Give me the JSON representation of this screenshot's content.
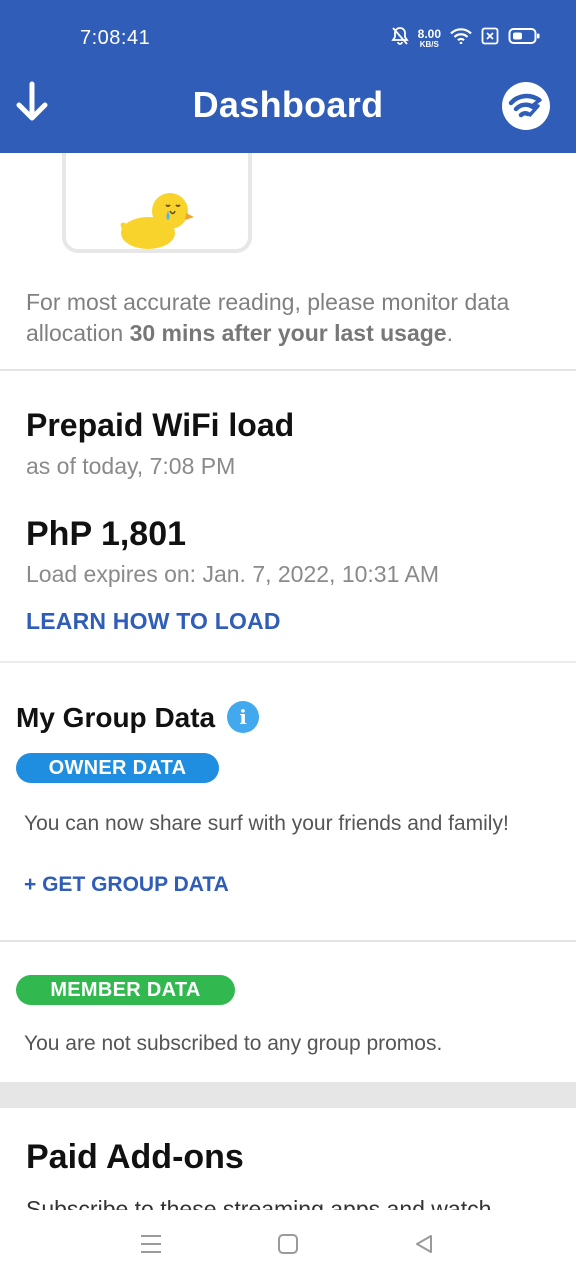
{
  "status_bar": {
    "time": "7:08:41",
    "speed_value": "8.00",
    "speed_unit": "KB/S",
    "icons": [
      "bell-muted-icon",
      "wifi-icon",
      "sim-blocked-icon",
      "battery-icon"
    ]
  },
  "app_bar": {
    "title": "Dashboard",
    "left_icon": "arrow-down-icon",
    "right_icon": "wifi-logo-icon",
    "color": "#2f5db7"
  },
  "usage_note": {
    "text_before": "For most accurate reading, please monitor data allocation ",
    "text_bold": "30 mins after your last usage",
    "text_after": "."
  },
  "prepaid": {
    "title": "Prepaid WiFi load",
    "as_of": "as of today, 7:08 PM",
    "amount": "PhP 1,801",
    "expires": "Load expires on: Jan. 7, 2022, 10:31 AM",
    "learn_link": "LEARN HOW TO LOAD"
  },
  "group_data": {
    "title": "My Group Data",
    "owner_badge": "OWNER DATA",
    "owner_desc": "You can now share surf with your friends and family!",
    "get_link": "+ GET GROUP DATA",
    "member_badge": "MEMBER DATA",
    "member_desc": "You are not subscribed to any group promos.",
    "owner_color": "#1f8ee0",
    "member_color": "#31b94f"
  },
  "addons": {
    "title": "Paid Add-ons",
    "subtitle": "Subscribe to these streaming apps and watch"
  },
  "nav_bar": {
    "icons": [
      "menu-icon",
      "home-icon",
      "back-icon"
    ]
  }
}
